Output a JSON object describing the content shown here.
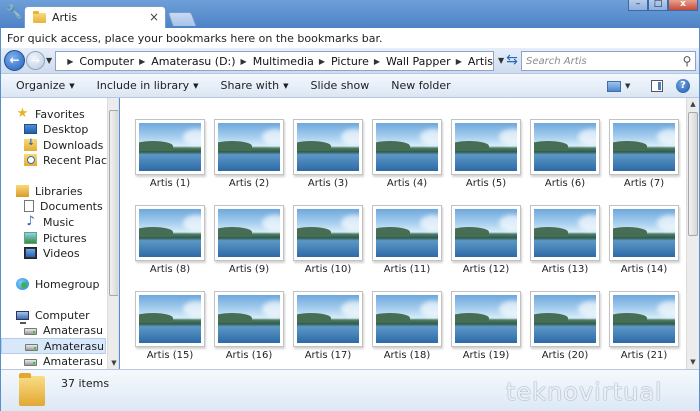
{
  "tab": {
    "title": "Artis"
  },
  "window_controls": {
    "minimize": "–",
    "maximize": "□",
    "close": "x"
  },
  "bookmarks_bar": {
    "text": "For quick access, place your bookmarks here on the bookmarks bar."
  },
  "address": {
    "breadcrumbs": [
      "Computer",
      "Amaterasu (D:)",
      "Multimedia",
      "Picture",
      "Wall Papper",
      "Artis"
    ]
  },
  "search": {
    "placeholder": "Search Artis"
  },
  "commands": [
    {
      "label": "Organize",
      "dropdown": true
    },
    {
      "label": "Include in library",
      "dropdown": true
    },
    {
      "label": "Share with",
      "dropdown": true
    },
    {
      "label": "Slide show",
      "dropdown": false
    },
    {
      "label": "New folder",
      "dropdown": false
    }
  ],
  "navigation": {
    "items": [
      {
        "label": "Favorites",
        "icon": "star-icon",
        "level": 0,
        "selected": false
      },
      {
        "label": "Desktop",
        "icon": "desktop-icon",
        "level": 1,
        "selected": false
      },
      {
        "label": "Downloads",
        "icon": "downloads-icon",
        "level": 1,
        "selected": false
      },
      {
        "label": "Recent Places",
        "icon": "recent-places-icon",
        "level": 1,
        "selected": false
      },
      {
        "label": "Libraries",
        "icon": "library-icon",
        "level": 0,
        "selected": false
      },
      {
        "label": "Documents",
        "icon": "documents-icon",
        "level": 1,
        "selected": false
      },
      {
        "label": "Music",
        "icon": "music-icon",
        "level": 1,
        "selected": false
      },
      {
        "label": "Pictures",
        "icon": "pictures-icon",
        "level": 1,
        "selected": false
      },
      {
        "label": "Videos",
        "icon": "videos-icon",
        "level": 1,
        "selected": false
      },
      {
        "label": "Homegroup",
        "icon": "homegroup-icon",
        "level": 0,
        "selected": false
      },
      {
        "label": "Computer",
        "icon": "computer-icon",
        "level": 0,
        "selected": false
      },
      {
        "label": "Amaterasu (C:)",
        "icon": "drive-icon",
        "level": 1,
        "selected": false
      },
      {
        "label": "Amaterasu (D:)",
        "icon": "drive-icon",
        "level": 1,
        "selected": true
      },
      {
        "label": "Amaterasu (E:)",
        "icon": "drive-icon",
        "level": 1,
        "selected": false
      }
    ]
  },
  "files": [
    "Artis (1)",
    "Artis (2)",
    "Artis (3)",
    "Artis (4)",
    "Artis (5)",
    "Artis (6)",
    "Artis (7)",
    "Artis (8)",
    "Artis (9)",
    "Artis (10)",
    "Artis (11)",
    "Artis (12)",
    "Artis (13)",
    "Artis (14)",
    "Artis (15)",
    "Artis (16)",
    "Artis (17)",
    "Artis (18)",
    "Artis (19)",
    "Artis (20)",
    "Artis (21)"
  ],
  "details": {
    "items_count": "37 items"
  },
  "watermark": "teknovirtual",
  "colors": {
    "accent": "#4d82c6",
    "selection": "#d9e8f9"
  }
}
